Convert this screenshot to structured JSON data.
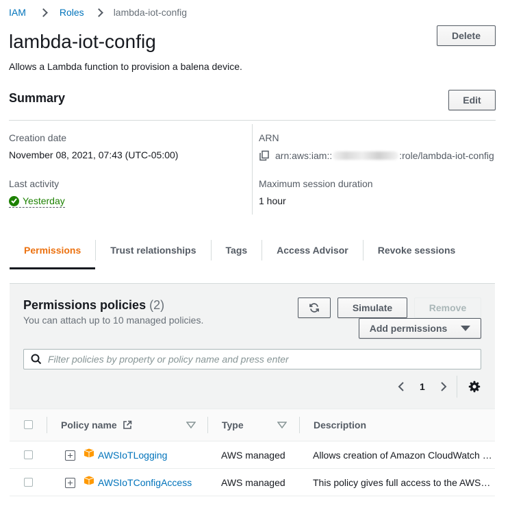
{
  "breadcrumb": {
    "items": [
      "IAM",
      "Roles"
    ],
    "current": "lambda-iot-config"
  },
  "header": {
    "title": "lambda-iot-config",
    "description": "Allows a Lambda function to provision a balena device.",
    "delete_label": "Delete"
  },
  "summary": {
    "title": "Summary",
    "edit_label": "Edit",
    "creation_date_label": "Creation date",
    "creation_date_value": "November 08, 2021, 07:43 (UTC-05:00)",
    "last_activity_label": "Last activity",
    "last_activity_value": "Yesterday",
    "arn_label": "ARN",
    "arn_prefix": "arn:aws:iam::",
    "arn_suffix": ":role/lambda-iot-config",
    "max_session_label": "Maximum session duration",
    "max_session_value": "1 hour"
  },
  "tabs": [
    {
      "label": "Permissions",
      "active": true
    },
    {
      "label": "Trust relationships",
      "active": false
    },
    {
      "label": "Tags",
      "active": false
    },
    {
      "label": "Access Advisor",
      "active": false
    },
    {
      "label": "Revoke sessions",
      "active": false
    }
  ],
  "permissions": {
    "title": "Permissions policies",
    "count": "(2)",
    "subtitle": "You can attach up to 10 managed policies.",
    "simulate_label": "Simulate",
    "remove_label": "Remove",
    "add_label": "Add permissions",
    "search_placeholder": "Filter policies by property or policy name and press enter",
    "page_number": "1"
  },
  "table": {
    "columns": [
      "Policy name",
      "Type",
      "Description"
    ],
    "rows": [
      {
        "name": "AWSIoTLogging",
        "type": "AWS managed",
        "description": "Allows creation of Amazon CloudWatch Log Groups"
      },
      {
        "name": "AWSIoTConfigAccess",
        "type": "AWS managed",
        "description": "This policy gives full access to the AWS IoT"
      }
    ]
  },
  "colors": {
    "link": "#0073bb",
    "active_tab": "#ec7211",
    "success": "#1d8102",
    "policy_icon": "#f90"
  }
}
